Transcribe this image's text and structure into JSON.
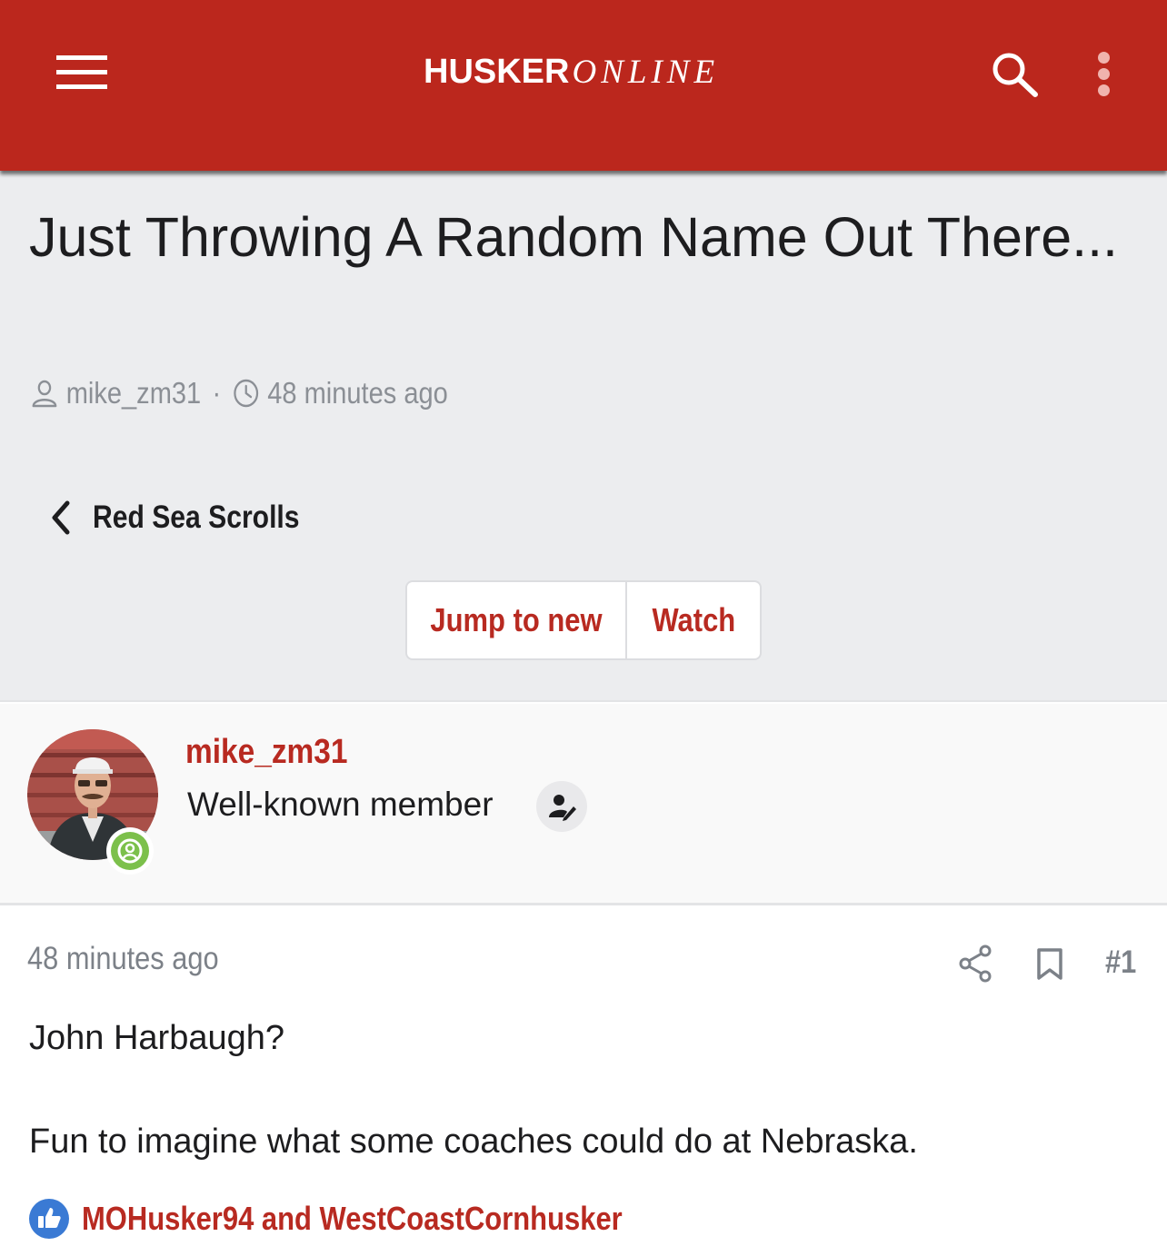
{
  "header": {
    "logo_bold": "HUSKER",
    "logo_italic": "ONLINE",
    "icons": {
      "menu": "hamburger-menu-icon",
      "search": "search-icon",
      "more": "vertical-ellipsis-icon"
    }
  },
  "thread": {
    "title": "Just Throwing A Random Name Out There...",
    "author": "mike_zm31",
    "separator": "·",
    "posted": "48 minutes ago",
    "forum": "Red Sea Scrolls",
    "actions": {
      "jump": "Jump to new",
      "watch": "Watch"
    }
  },
  "post": {
    "author_name": "mike_zm31",
    "author_role": "Well-known member",
    "time": "48 minutes ago",
    "number": "#1",
    "body": [
      "John Harbaugh?",
      "Fun to imagine what some coaches could do at Nebraska."
    ],
    "reactions": "MOHusker94 and WestCoastCornhusker"
  },
  "colors": {
    "brand_red": "#bb271d",
    "link_red": "#b82a21",
    "online_green": "#7cc04b",
    "like_blue": "#3a7ad4"
  }
}
